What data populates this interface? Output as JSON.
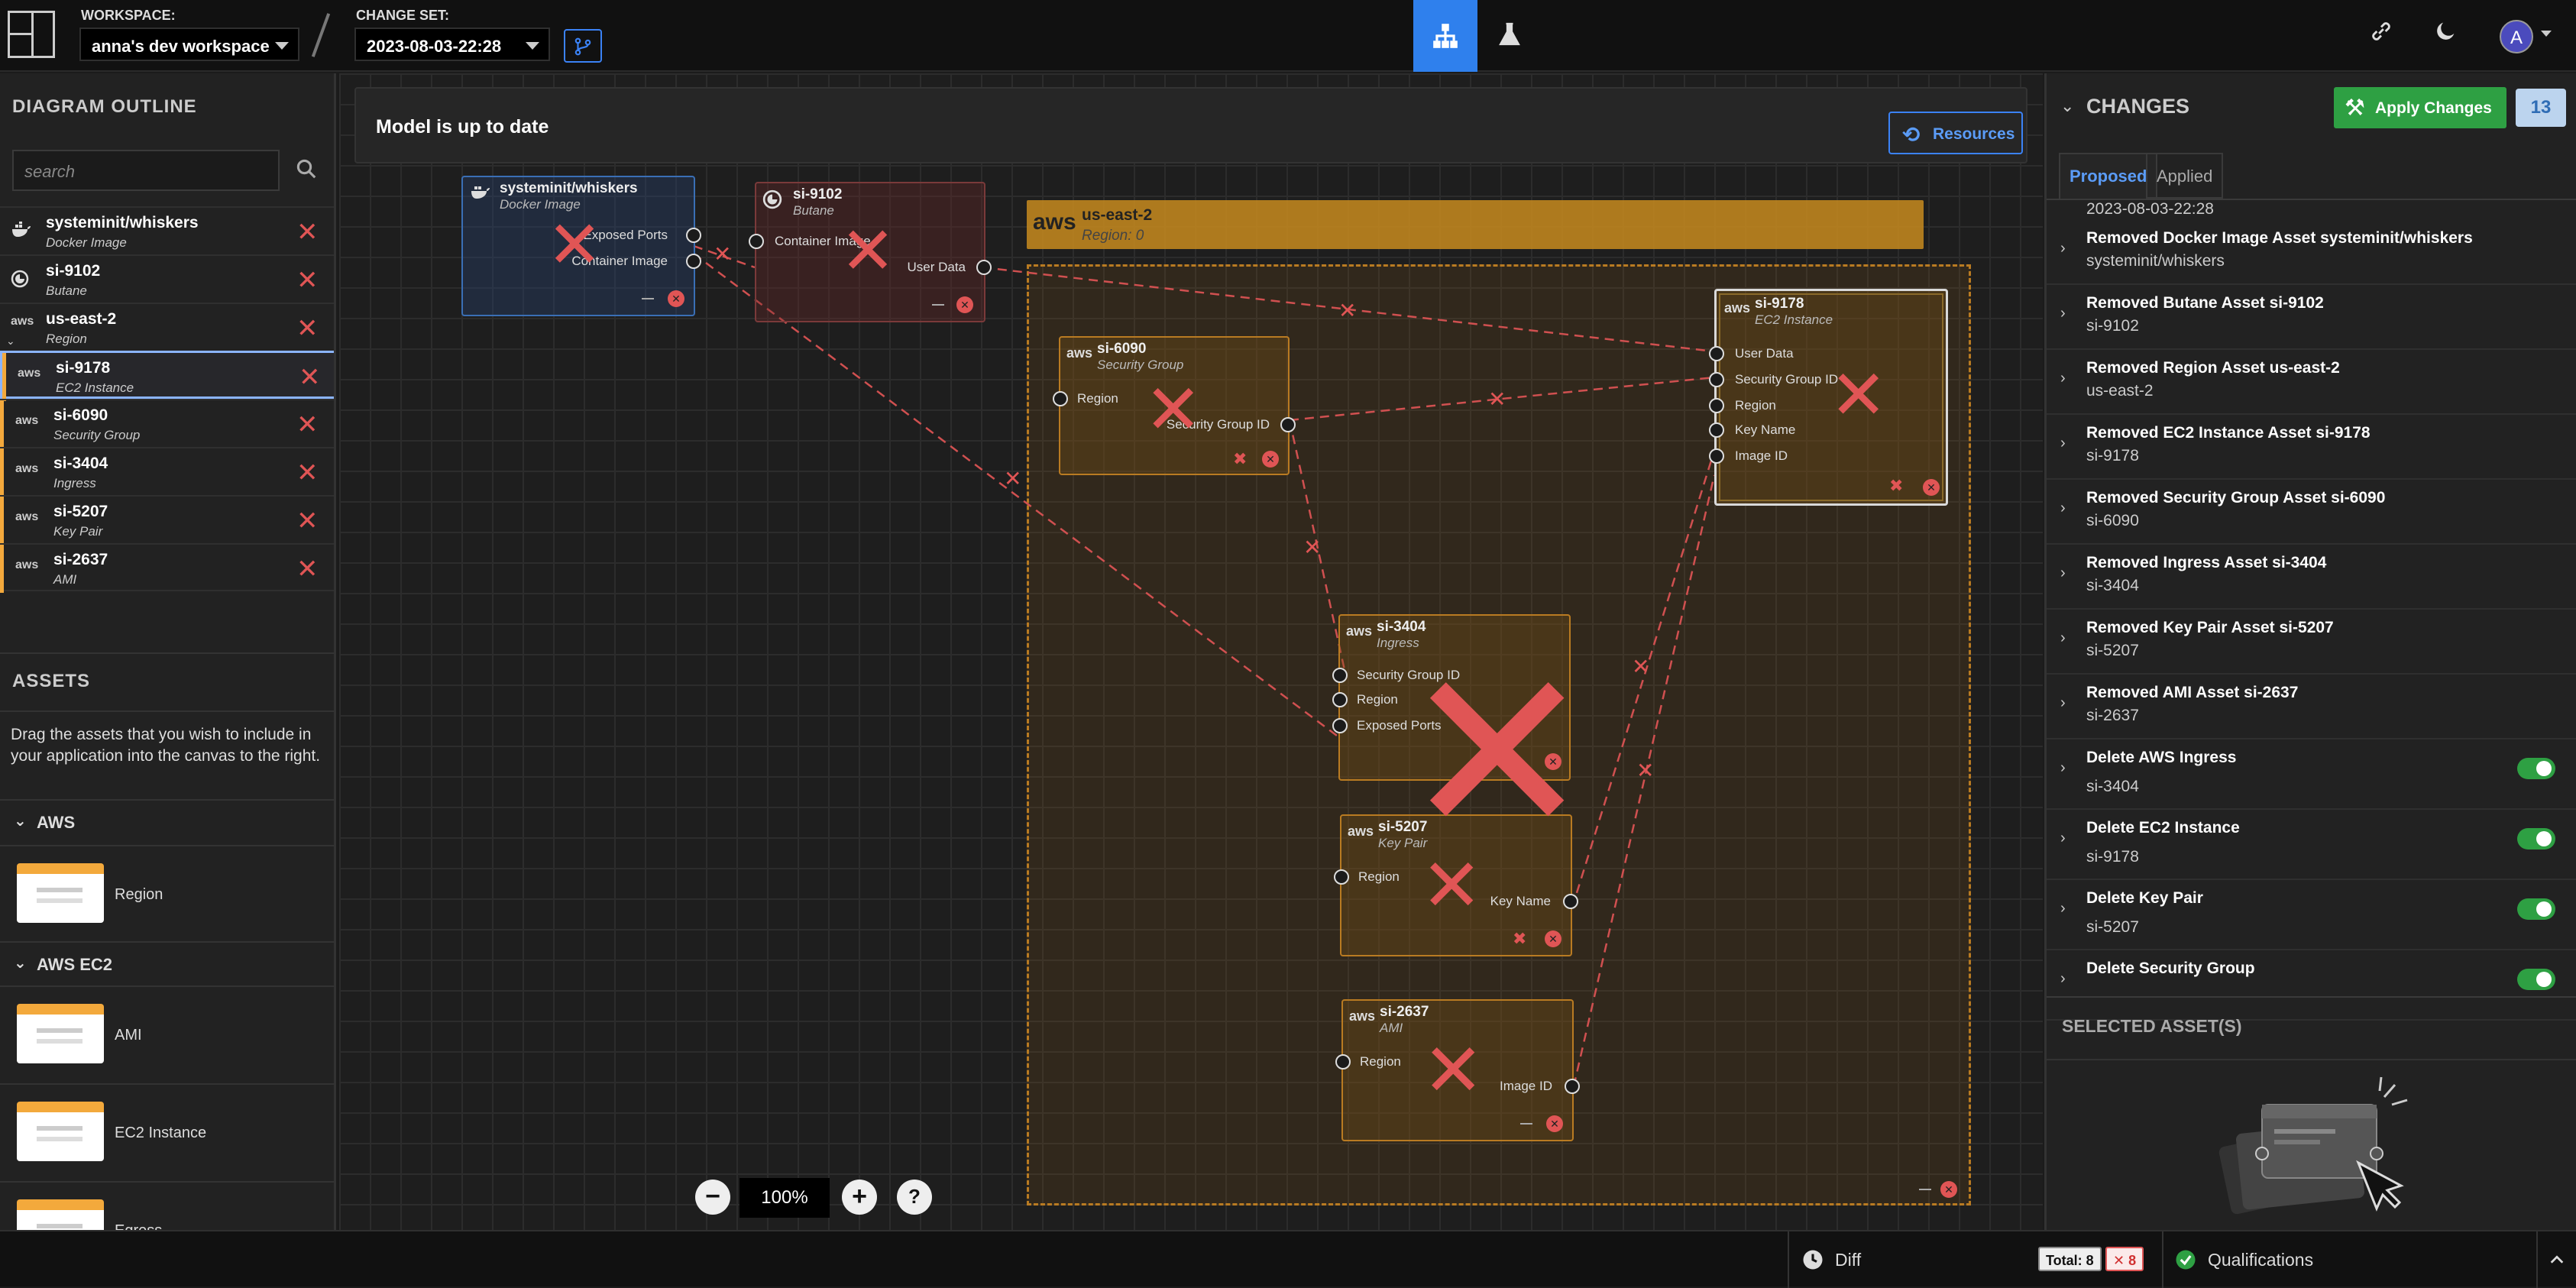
{
  "topbar": {
    "workspace_label": "WORKSPACE:",
    "workspace_value": "anna's dev workspace",
    "changeset_label": "CHANGE SET:",
    "changeset_value": "2023-08-03-22:28",
    "avatar_letter": "A"
  },
  "outline": {
    "title": "DIAGRAM OUTLINE",
    "search_placeholder": "search",
    "items": [
      {
        "name": "systeminit/whiskers",
        "type": "Docker Image",
        "icon": "docker-icon"
      },
      {
        "name": "si-9102",
        "type": "Butane",
        "icon": "butane-icon"
      },
      {
        "name": "us-east-2",
        "type": "Region",
        "icon": "aws-icon"
      },
      {
        "name": "si-9178",
        "type": "EC2 Instance",
        "icon": "aws-icon"
      },
      {
        "name": "si-6090",
        "type": "Security Group",
        "icon": "aws-icon"
      },
      {
        "name": "si-3404",
        "type": "Ingress",
        "icon": "aws-icon"
      },
      {
        "name": "si-5207",
        "type": "Key Pair",
        "icon": "aws-icon"
      },
      {
        "name": "si-2637",
        "type": "AMI",
        "icon": "aws-icon"
      }
    ]
  },
  "assets": {
    "title": "ASSETS",
    "description": "Drag the assets that you wish to include in your application into the canvas to the right.",
    "categories": [
      {
        "name": "AWS",
        "items": [
          "Region"
        ]
      },
      {
        "name": "AWS EC2",
        "items": [
          "AMI",
          "EC2 Instance",
          "Egress"
        ]
      }
    ]
  },
  "canvas": {
    "status": "Model is up to date",
    "resources_label": "Resources",
    "zoom": "100%",
    "aws_label": "aws",
    "nodes": {
      "docker": {
        "name": "systeminit/whiskers",
        "type": "Docker Image",
        "sockets": [
          "Exposed Ports",
          "Container Image"
        ]
      },
      "butane": {
        "name": "si-9102",
        "type": "Butane",
        "sockets": [
          "Container Image",
          "User Data"
        ]
      },
      "region": {
        "name": "us-east-2",
        "type": "Region: 0"
      },
      "secgroup": {
        "name": "si-6090",
        "type": "Security Group",
        "sockets": [
          "Region",
          "Security Group ID"
        ]
      },
      "ec2": {
        "name": "si-9178",
        "type": "EC2 Instance",
        "sockets": [
          "User Data",
          "Security Group ID",
          "Region",
          "Key Name",
          "Image ID"
        ]
      },
      "ingress": {
        "name": "si-3404",
        "type": "Ingress",
        "sockets": [
          "Security Group ID",
          "Region",
          "Exposed Ports"
        ]
      },
      "keypair": {
        "name": "si-5207",
        "type": "Key Pair",
        "sockets": [
          "Region",
          "Key Name"
        ]
      },
      "ami": {
        "name": "si-2637",
        "type": "AMI",
        "sockets": [
          "Region",
          "Image ID"
        ]
      }
    }
  },
  "changes": {
    "title": "CHANGES",
    "apply_label": "Apply Changes",
    "count": "13",
    "tabs": [
      "Proposed",
      "Applied"
    ],
    "top_timestamp": "2023-08-03-22:28",
    "items": [
      {
        "title": "Removed Docker Image Asset systeminit/whiskers",
        "sub": "systeminit/whiskers",
        "toggle": false
      },
      {
        "title": "Removed Butane Asset si-9102",
        "sub": "si-9102",
        "toggle": false
      },
      {
        "title": "Removed Region Asset us-east-2",
        "sub": "us-east-2",
        "toggle": false
      },
      {
        "title": "Removed EC2 Instance Asset si-9178",
        "sub": "si-9178",
        "toggle": false
      },
      {
        "title": "Removed Security Group Asset si-6090",
        "sub": "si-6090",
        "toggle": false
      },
      {
        "title": "Removed Ingress Asset si-3404",
        "sub": "si-3404",
        "toggle": false
      },
      {
        "title": "Removed Key Pair Asset si-5207",
        "sub": "si-5207",
        "toggle": false
      },
      {
        "title": "Removed AMI Asset si-2637",
        "sub": "si-2637",
        "toggle": false
      },
      {
        "title": "Delete AWS Ingress",
        "sub": "si-3404",
        "toggle": true
      },
      {
        "title": "Delete EC2 Instance",
        "sub": "si-9178",
        "toggle": true
      },
      {
        "title": "Delete Key Pair",
        "sub": "si-5207",
        "toggle": true
      },
      {
        "title": "Delete Security Group",
        "sub": "",
        "toggle": true
      }
    ],
    "selected_title": "SELECTED ASSET(S)"
  },
  "bottombar": {
    "diff_label": "Diff",
    "total_label": "Total: 8",
    "error_label": "✕ 8",
    "qualifications_label": "Qualifications"
  },
  "colors": {
    "accent": "#2f80ed",
    "apply_green": "#2ea043",
    "delete_red": "#e05555",
    "region_orange": "#c88b1e"
  }
}
